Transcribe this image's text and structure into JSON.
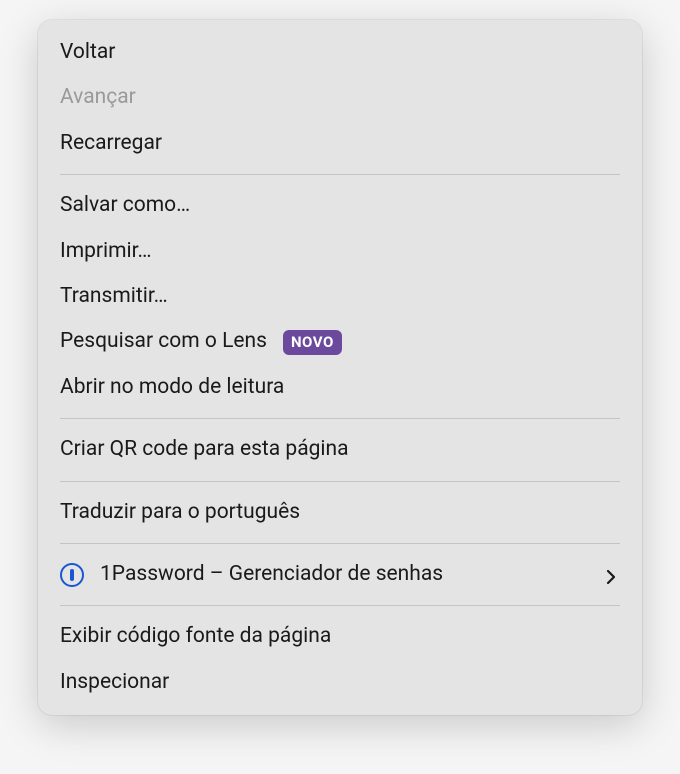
{
  "menu": {
    "back": "Voltar",
    "forward": "Avançar",
    "reload": "Recarregar",
    "saveAs": "Salvar como…",
    "print": "Imprimir…",
    "cast": "Transmitir…",
    "searchLens": "Pesquisar com o Lens",
    "lensBadge": "NOVO",
    "readerMode": "Abrir no modo de leitura",
    "createQr": "Criar QR code para esta página",
    "translate": "Traduzir para o português",
    "onePassword": "1Password – Gerenciador de senhas",
    "viewSource": "Exibir código fonte da página",
    "inspect": "Inspecionar"
  }
}
